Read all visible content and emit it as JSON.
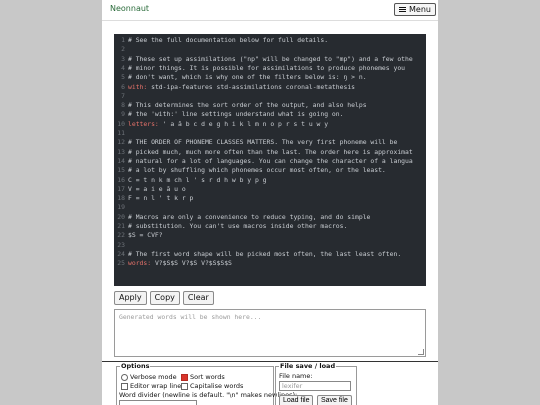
{
  "navbar": {
    "brand": "Neonnaut",
    "menu_label": "Menu"
  },
  "editor": {
    "lines": [
      {
        "n": "1",
        "parts": [
          {
            "t": "# See the full documentation below for full details.",
            "c": "comment"
          }
        ]
      },
      {
        "n": "2",
        "parts": []
      },
      {
        "n": "3",
        "parts": [
          {
            "t": "# These set up assimilations (\"np\" will be changed to \"mp\") and a few othe",
            "c": "comment"
          }
        ]
      },
      {
        "n": "4",
        "parts": [
          {
            "t": "# minor things. It is possible for assimilations to produce phonemes you",
            "c": "comment"
          }
        ]
      },
      {
        "n": "5",
        "parts": [
          {
            "t": "# don't want, which is why one of the filters below is: ŋ > n.",
            "c": "comment"
          }
        ]
      },
      {
        "n": "6",
        "parts": [
          {
            "t": "with:",
            "c": "key"
          },
          {
            "t": " std-ipa-features std-assimilations coronal-metathesis",
            "c": "val"
          }
        ]
      },
      {
        "n": "7",
        "parts": []
      },
      {
        "n": "8",
        "parts": [
          {
            "t": "# This determines the sort order of the output, and also helps",
            "c": "comment"
          }
        ]
      },
      {
        "n": "9",
        "parts": [
          {
            "t": "# the 'with:' line settings understand what is going on.",
            "c": "comment"
          }
        ]
      },
      {
        "n": "10",
        "parts": [
          {
            "t": "letters:",
            "c": "key"
          },
          {
            "t": " ' a ā b c d e g h i k l m n o p r s t u w y",
            "c": "val"
          }
        ]
      },
      {
        "n": "11",
        "parts": []
      },
      {
        "n": "12",
        "parts": [
          {
            "t": "# THE ORDER OF PHONEME CLASSES MATTERS. The very first phoneme will be",
            "c": "comment"
          }
        ]
      },
      {
        "n": "13",
        "parts": [
          {
            "t": "# picked much, much more often than the last. The order here is approximat",
            "c": "comment"
          }
        ]
      },
      {
        "n": "14",
        "parts": [
          {
            "t": "# natural for a lot of languages. You can change the character of a langua",
            "c": "comment"
          }
        ]
      },
      {
        "n": "15",
        "parts": [
          {
            "t": "# a lot by shuffling which phonemes occur most often, or the least.",
            "c": "comment"
          }
        ]
      },
      {
        "n": "16",
        "parts": [
          {
            "t": "C = t n k m ch l ' s r d h w b y p g",
            "c": "val"
          }
        ]
      },
      {
        "n": "17",
        "parts": [
          {
            "t": "V = a i e ā u o",
            "c": "val"
          }
        ]
      },
      {
        "n": "18",
        "parts": [
          {
            "t": "F = n l ' t k r p",
            "c": "val"
          }
        ]
      },
      {
        "n": "19",
        "parts": []
      },
      {
        "n": "20",
        "parts": [
          {
            "t": "# Macros are only a convenience to reduce typing, and do simple",
            "c": "comment"
          }
        ]
      },
      {
        "n": "21",
        "parts": [
          {
            "t": "# substitution. You can't use macros inside other macros.",
            "c": "comment"
          }
        ]
      },
      {
        "n": "22",
        "parts": [
          {
            "t": "$S = CVF?",
            "c": "val"
          }
        ]
      },
      {
        "n": "23",
        "parts": []
      },
      {
        "n": "24",
        "parts": [
          {
            "t": "# The first word shape will be picked most often, the last least often.",
            "c": "comment"
          }
        ]
      },
      {
        "n": "25",
        "parts": [
          {
            "t": "words:",
            "c": "key"
          },
          {
            "t": " V?$S$S V?$S V?$S$S$S",
            "c": "val"
          }
        ]
      }
    ]
  },
  "actions": {
    "apply": "Apply",
    "copy": "Copy",
    "clear": "Clear"
  },
  "output": {
    "placeholder": "Generated words will be shown here..."
  },
  "options": {
    "legend": "Options",
    "verbose": "Verbose mode",
    "sort_words": "Sort words",
    "editor_wrap": "Editor wrap lines",
    "capitalise": "Capitalise words",
    "word_divider_label": "Word divider (newline is default. \"\\n\" makes newlines):",
    "sort_words_checked": true,
    "capitalise_checked": false,
    "editor_wrap_checked": false,
    "verbose_selected": false
  },
  "file": {
    "legend": "File save / load",
    "name_label": "File name:",
    "name_placeholder": "lexifer",
    "load": "Load file",
    "save": "Save file"
  }
}
